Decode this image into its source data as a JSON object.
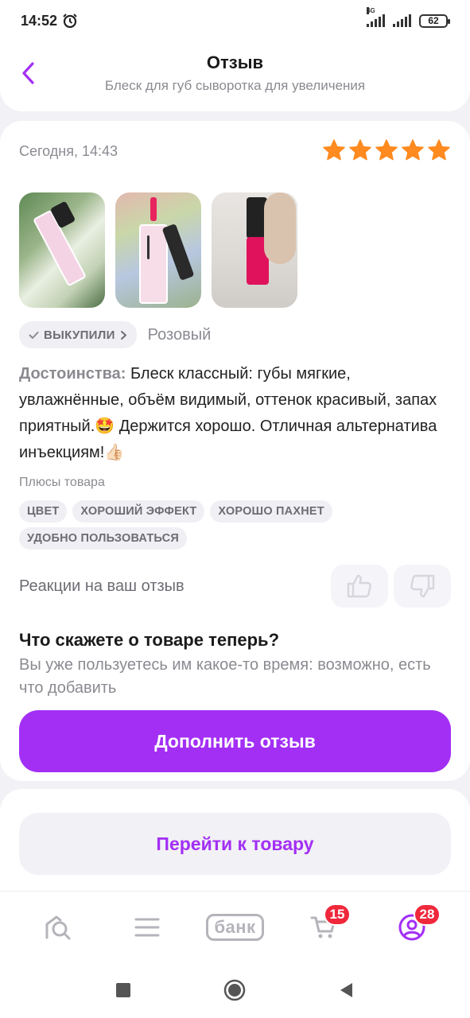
{
  "status_bar": {
    "time": "14:52",
    "network": "4G",
    "battery": "62"
  },
  "header": {
    "title": "Отзыв",
    "subtitle": "Блеск для губ сыворотка для увеличения"
  },
  "review": {
    "date": "Сегодня, 14:43",
    "rating": 5,
    "bought_label": "ВЫКУПИЛИ",
    "color_option": "Розовый",
    "pros_label": "Достоинства:",
    "text": "Блеск классный: губы мягкие, увлажнённые, объём видимый, оттенок красивый, запах приятный.🤩 Держится хорошо. Отличная альтернатива инъекциям!👍🏻",
    "pros_title": "Плюсы товара",
    "tags": [
      "ЦВЕТ",
      "ХОРОШИЙ ЭФФЕКТ",
      "ХОРОШО ПАХНЕТ",
      "УДОБНО ПОЛЬЗОВАТЬСЯ"
    ],
    "reactions_label": "Реакции на ваш отзыв"
  },
  "followup": {
    "title": "Что скажете о товаре теперь?",
    "text": "Вы уже пользуетесь им какое-то время: возможно, есть что добавить",
    "button": "Дополнить отзыв"
  },
  "goto_product_button": "Перейти к товару",
  "bottom_nav": {
    "bank_label": "банк",
    "cart_badge": "15",
    "profile_badge": "28"
  },
  "colors": {
    "accent": "#a32ff5",
    "star": "#ff8a1f",
    "badge": "#f0283c"
  },
  "icons": [
    "alarm-icon",
    "back-arrow-icon",
    "star-icon",
    "check-icon",
    "chevron-right-icon",
    "thumb-up-icon",
    "thumb-down-icon",
    "home-icon",
    "catalog-icon",
    "cart-icon",
    "profile-icon",
    "recent-apps-icon",
    "home-circle-icon",
    "back-triangle-icon"
  ]
}
